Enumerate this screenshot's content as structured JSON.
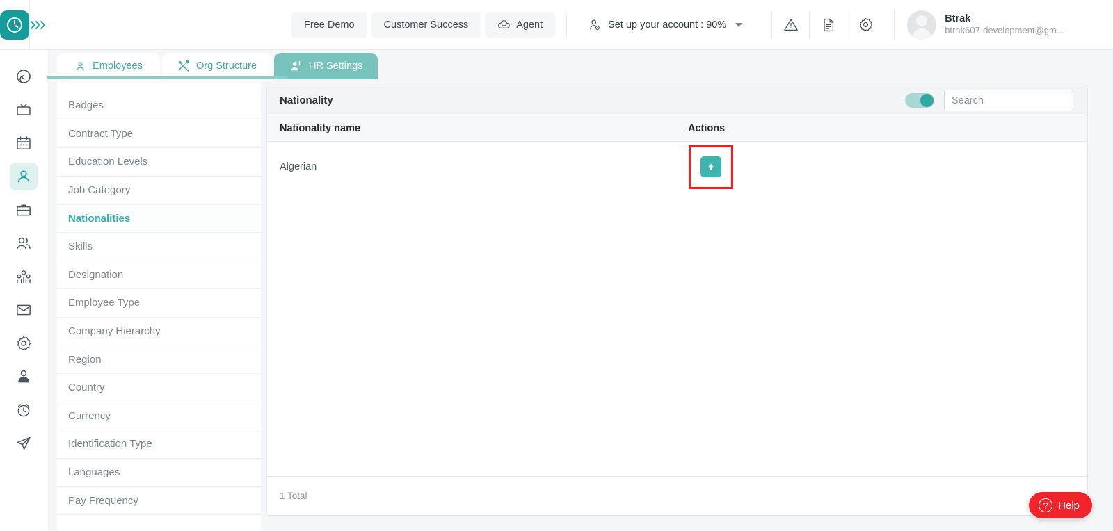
{
  "header": {
    "logo_icon": "clock-logo-icon",
    "expand_icon": "chevron-double-right-icon",
    "nav_buttons": [
      {
        "label": "Free Demo",
        "icon": null
      },
      {
        "label": "Customer Success",
        "icon": null
      },
      {
        "label": "Agent",
        "icon": "cloud-download-icon"
      }
    ],
    "setup": {
      "label": "Set up your account : 90%",
      "icon": "user-gear-icon"
    },
    "icons": [
      {
        "name": "warning-triangle-icon"
      },
      {
        "name": "document-icon"
      },
      {
        "name": "gear-icon"
      }
    ],
    "user": {
      "name": "Btrak",
      "email": "btrak607-development@gm...",
      "avatar": "avatar"
    }
  },
  "rail": {
    "items": [
      {
        "name": "target-icon",
        "active": false
      },
      {
        "name": "tv-icon",
        "active": false
      },
      {
        "name": "calendar-icon",
        "active": false
      },
      {
        "name": "person-icon",
        "active": true
      },
      {
        "name": "briefcase-icon",
        "active": false
      },
      {
        "name": "users-icon",
        "active": false
      },
      {
        "name": "org-people-icon",
        "active": false
      },
      {
        "name": "mail-icon",
        "active": false
      },
      {
        "name": "gear-icon",
        "active": false
      },
      {
        "name": "user-badge-icon",
        "active": false
      },
      {
        "name": "alarm-clock-icon",
        "active": false
      },
      {
        "name": "send-icon",
        "active": false
      }
    ]
  },
  "tabs": [
    {
      "label": "Employees",
      "icon": "person-icon",
      "active": false
    },
    {
      "label": "Org Structure",
      "icon": "tools-icon",
      "active": false
    },
    {
      "label": "HR Settings",
      "icon": "user-add-icon",
      "active": true
    }
  ],
  "settings_list": {
    "items": [
      {
        "label": "Badges",
        "active": false
      },
      {
        "label": "Contract Type",
        "active": false
      },
      {
        "label": "Education Levels",
        "active": false
      },
      {
        "label": "Job Category",
        "active": false
      },
      {
        "label": "Nationalities",
        "active": true
      },
      {
        "label": "Skills",
        "active": false
      },
      {
        "label": "Designation",
        "active": false
      },
      {
        "label": "Employee Type",
        "active": false
      },
      {
        "label": "Company Hierarchy",
        "active": false
      },
      {
        "label": "Region",
        "active": false
      },
      {
        "label": "Country",
        "active": false
      },
      {
        "label": "Currency",
        "active": false
      },
      {
        "label": "Identification Type",
        "active": false
      },
      {
        "label": "Languages",
        "active": false
      },
      {
        "label": "Pay Frequency",
        "active": false
      }
    ]
  },
  "panel": {
    "title": "Nationality",
    "toggle_on": true,
    "search_placeholder": "Search",
    "search_value": "",
    "columns": [
      "Nationality name",
      "Actions"
    ],
    "rows": [
      {
        "name": "Algerian",
        "action_icon": "upload-icon"
      }
    ],
    "footer_total": "1 Total"
  },
  "help": {
    "label": "Help",
    "icon": "question-mark-icon"
  },
  "colors": {
    "brand_teal": "#169b9b",
    "tab_active": "#79c3bd",
    "link_teal": "#2fb3ab",
    "action_teal": "#3fb3ad",
    "highlight_red": "#fc1c1c",
    "help_red": "#f0242a"
  }
}
